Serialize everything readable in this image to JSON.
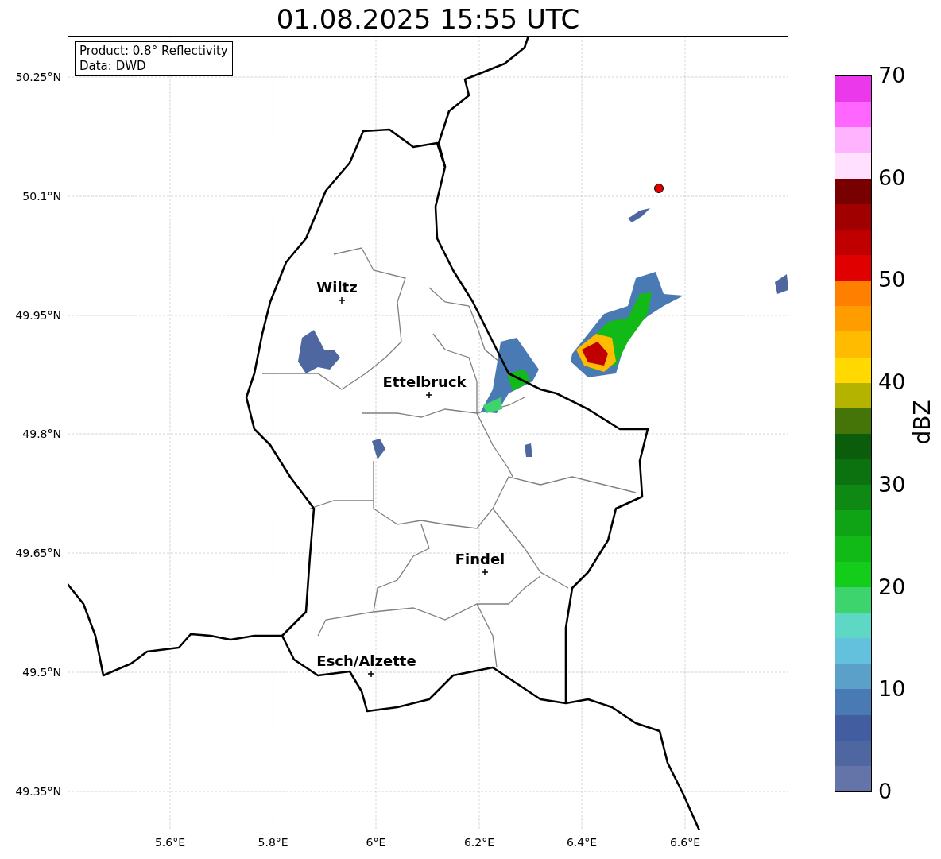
{
  "title": "01.08.2025 15:55 UTC",
  "info_box": [
    "Product: 0.8° Reflectivity",
    "Data: DWD"
  ],
  "y_ticks": [
    "50.25°N",
    "50.1°N",
    "49.95°N",
    "49.8°N",
    "49.65°N",
    "49.5°N",
    "49.35°N"
  ],
  "x_ticks": [
    "5.6°E",
    "5.8°E",
    "6°E",
    "6.2°E",
    "6.4°E",
    "6.6°E"
  ],
  "cities": [
    {
      "name": "Wiltz"
    },
    {
      "name": "Ettelbruck"
    },
    {
      "name": "Findel"
    },
    {
      "name": "Esch/Alzette"
    }
  ],
  "colorbar": {
    "label": "dBZ",
    "ticks": [
      "70",
      "60",
      "50",
      "40",
      "30",
      "20",
      "10",
      "0"
    ],
    "segments": [
      {
        "color": "#ea38ea"
      },
      {
        "color": "#ff66ff"
      },
      {
        "color": "#ffb3ff"
      },
      {
        "color": "#ffe0ff"
      },
      {
        "color": "#780000"
      },
      {
        "color": "#a00000"
      },
      {
        "color": "#c00000"
      },
      {
        "color": "#e00000"
      },
      {
        "color": "#ff8000"
      },
      {
        "color": "#ff9d00"
      },
      {
        "color": "#ffbb00"
      },
      {
        "color": "#ffd900"
      },
      {
        "color": "#b3b300"
      },
      {
        "color": "#457509"
      },
      {
        "color": "#0b5c0b"
      },
      {
        "color": "#0b720f"
      },
      {
        "color": "#0e8a14"
      },
      {
        "color": "#0fa316"
      },
      {
        "color": "#12ba18"
      },
      {
        "color": "#14cc1a"
      },
      {
        "color": "#3dd46e"
      },
      {
        "color": "#5ed8c4"
      },
      {
        "color": "#63c1de"
      },
      {
        "color": "#5aa0c8"
      },
      {
        "color": "#4a7ab3"
      },
      {
        "color": "#435ea0"
      },
      {
        "color": "#4f67a0"
      },
      {
        "color": "#6474a8"
      }
    ]
  }
}
